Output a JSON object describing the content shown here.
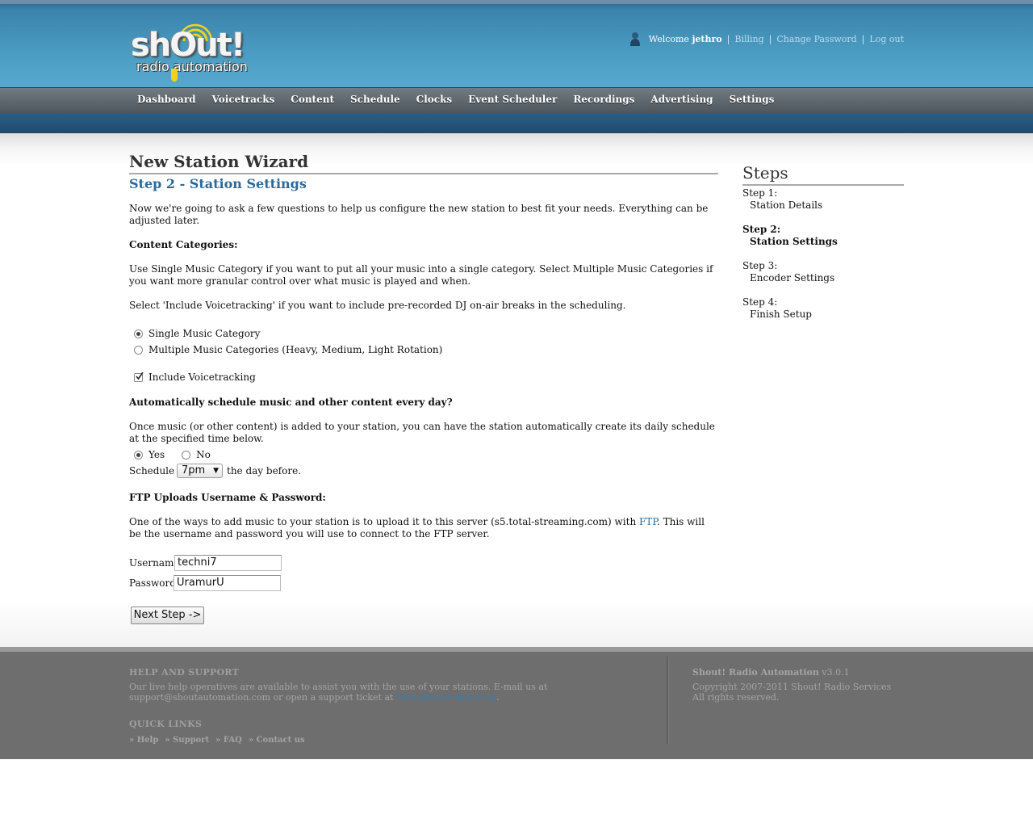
{
  "header": {
    "logo_main": "shOut!",
    "logo_sub": "radio automation",
    "welcome_prefix": "Welcome",
    "username": "jethro",
    "links": [
      "Billing",
      "Change Password",
      "Log out"
    ]
  },
  "nav": {
    "items": [
      "Dashboard",
      "Voicetracks",
      "Content",
      "Schedule",
      "Clocks",
      "Event Scheduler",
      "Recordings",
      "Advertising",
      "Settings"
    ]
  },
  "main": {
    "title": "New Station Wizard",
    "step_title": "Step 2 - Station Settings",
    "intro": "Now we're going to ask a few questions to help us configure the new station to best fit your needs. Everything can be adjusted later.",
    "content_categories": {
      "heading": "Content Categories:",
      "desc1": "Use Single Music Category if you want to put all your music into a single category. Select Multiple Music Categories if you want more granular control over what music is played and when.",
      "desc2": "Select 'Include Voicetracking' if you want to include pre-recorded DJ on-air breaks in the scheduling.",
      "option_single": "Single Music Category",
      "option_multiple": "Multiple Music Categories (Heavy, Medium, Light Rotation)",
      "selected": "Single Music Category",
      "voicetracking_label": "Include Voicetracking",
      "voicetracking_checked": true
    },
    "auto_schedule": {
      "heading": "Automatically schedule music and other content every day?",
      "desc": "Once music (or other content) is added to your station, you can have the station automatically create its daily schedule at the specified time below.",
      "yes_label": "Yes",
      "no_label": "No",
      "selected": "Yes",
      "schedule_prefix": "Schedule at",
      "schedule_value": "7pm",
      "schedule_suffix": "the day before."
    },
    "ftp": {
      "heading": "FTP Uploads Username & Password:",
      "desc_before": "One of the ways to add music to your station is to upload it to this server (s5.total-streaming.com) with ",
      "desc_link": "FTP",
      "desc_after": ". This will be the username and password you will use to connect to the FTP server.",
      "username_label": "Username:",
      "username_value": "techni7",
      "password_label": "Password:",
      "password_value": "UramurU"
    },
    "next_button": "Next Step ->"
  },
  "sidebar": {
    "title": "Steps",
    "steps": [
      {
        "label": "Step 1:",
        "name": "Station Details"
      },
      {
        "label": "Step 2:",
        "name": "Station Settings"
      },
      {
        "label": "Step 3:",
        "name": "Encoder Settings"
      },
      {
        "label": "Step 4:",
        "name": "Finish Setup"
      }
    ],
    "active_step": "Step 2:"
  },
  "footer": {
    "help_heading": "HELP AND SUPPORT",
    "help_text": "Our live help operatives are available to assist you with the use of your stations. E-mail us at support@shoutautomation.com or open a support ticket at",
    "help_link": "ShoutAutomation.com",
    "help_end": ".",
    "quick_heading": "QUICK LINKS",
    "quick_links": [
      "Help",
      "Support",
      "FAQ",
      "Contact us"
    ],
    "product_name": "Shout! Radio Automation",
    "version": "v3.0.1",
    "copyright": "Copyright 2007-2011 Shout! Radio Services",
    "rights": "All rights reserved."
  }
}
